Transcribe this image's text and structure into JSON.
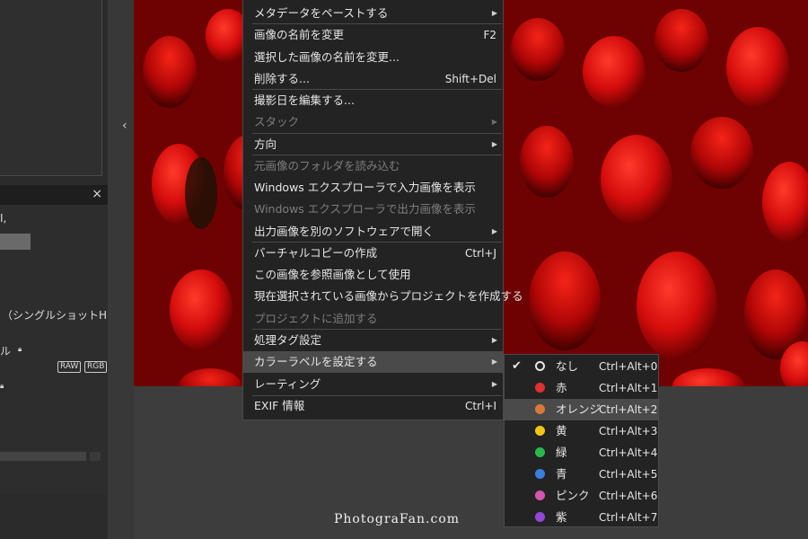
{
  "left_panel": {
    "text_line": "I,",
    "hdr_text": "（シングルショットHDR）",
    "label": "ル",
    "tag_raw": "RAW",
    "tag_rgb": "RGB",
    "close_symbol": "×",
    "collapse_symbol": "‹"
  },
  "menu": {
    "items": [
      {
        "label": "メタデータをペーストする",
        "shortcut": "",
        "arrow": true,
        "disabled": false
      },
      {
        "label": "画像の名前を変更",
        "shortcut": "F2",
        "arrow": false,
        "disabled": false
      },
      {
        "label": "選択した画像の名前を変更...",
        "shortcut": "",
        "arrow": false,
        "disabled": false
      },
      {
        "label": "削除する...",
        "shortcut": "Shift+Del",
        "arrow": false,
        "disabled": false
      },
      {
        "label": "撮影日を編集する...",
        "shortcut": "",
        "arrow": false,
        "disabled": false
      },
      {
        "label": "スタック",
        "shortcut": "",
        "arrow": true,
        "disabled": true
      },
      {
        "label": "方向",
        "shortcut": "",
        "arrow": true,
        "disabled": false
      },
      {
        "label": "元画像のフォルダを読み込む",
        "shortcut": "",
        "arrow": false,
        "disabled": true
      },
      {
        "label": "Windows エクスプローラで入力画像を表示",
        "shortcut": "",
        "arrow": false,
        "disabled": false
      },
      {
        "label": "Windows エクスプローラで出力画像を表示",
        "shortcut": "",
        "arrow": false,
        "disabled": true
      },
      {
        "label": "出力画像を別のソフトウェアで開く",
        "shortcut": "",
        "arrow": true,
        "disabled": false
      },
      {
        "label": "バーチャルコピーの作成",
        "shortcut": "Ctrl+J",
        "arrow": false,
        "disabled": false
      },
      {
        "label": "この画像を参照画像として使用",
        "shortcut": "",
        "arrow": false,
        "disabled": false
      },
      {
        "label": "現在選択されている画像からプロジェクトを作成する",
        "shortcut": "",
        "arrow": false,
        "disabled": false
      },
      {
        "label": "プロジェクトに追加する",
        "shortcut": "",
        "arrow": false,
        "disabled": true
      },
      {
        "label": "処理タグ設定",
        "shortcut": "",
        "arrow": true,
        "disabled": false
      },
      {
        "label": "カラーラベルを設定する",
        "shortcut": "",
        "arrow": true,
        "disabled": false,
        "highlighted": true
      },
      {
        "label": "レーティング",
        "shortcut": "",
        "arrow": true,
        "disabled": false
      },
      {
        "label": "EXIF 情報",
        "shortcut": "Ctrl+I",
        "arrow": false,
        "disabled": false
      }
    ]
  },
  "color_label_submenu": {
    "checkmark": "✔",
    "items": [
      {
        "label": "なし",
        "shortcut": "Ctrl+Alt+0",
        "color": "none",
        "checked": true
      },
      {
        "label": "赤",
        "shortcut": "Ctrl+Alt+1",
        "color": "#e03030"
      },
      {
        "label": "オレンジ",
        "shortcut": "Ctrl+Alt+2",
        "color": "#d9783a",
        "highlighted": true
      },
      {
        "label": "黄",
        "shortcut": "Ctrl+Alt+3",
        "color": "#f0c419"
      },
      {
        "label": "緑",
        "shortcut": "Ctrl+Alt+4",
        "color": "#29b84e"
      },
      {
        "label": "青",
        "shortcut": "Ctrl+Alt+5",
        "color": "#3a7fe0"
      },
      {
        "label": "ピンク",
        "shortcut": "Ctrl+Alt+6",
        "color": "#d455b0"
      },
      {
        "label": "紫",
        "shortcut": "Ctrl+Alt+7",
        "color": "#9447d6"
      }
    ]
  },
  "watermark": "PhotograFan.com",
  "colors": {
    "menu_bg": "#232323",
    "highlight": "#4a4a4a",
    "photo_red": "#c80a0a"
  },
  "photo": {
    "subject": "red tulips"
  }
}
